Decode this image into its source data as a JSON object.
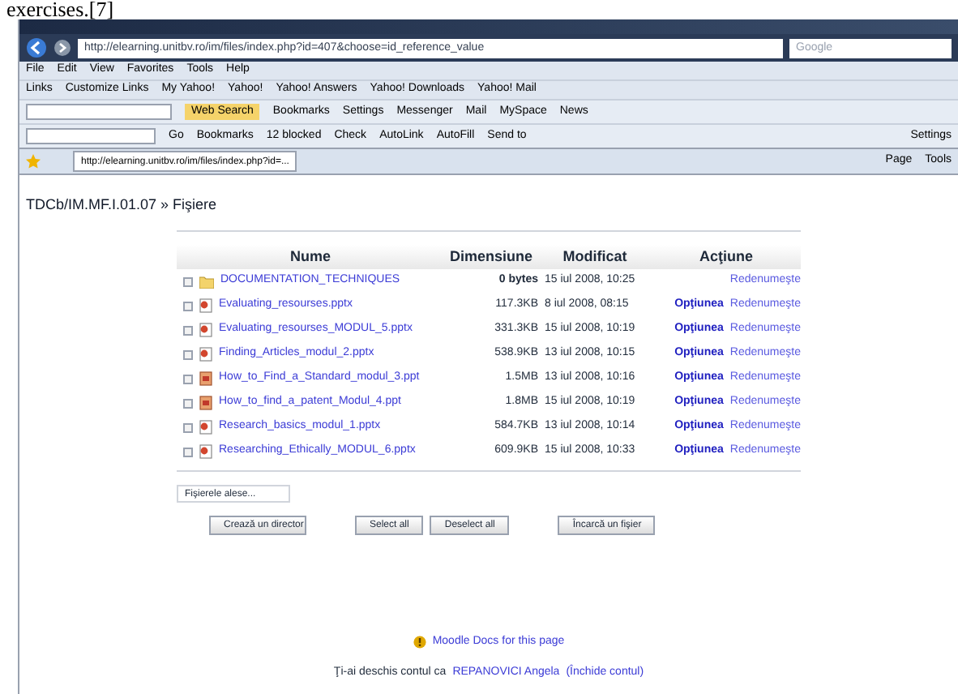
{
  "document_text": "exercises.[7]",
  "browser": {
    "address": "http://elearning.unitbv.ro/im/files/index.php?id=407&choose=id_reference_value",
    "search_placeholder": "Google",
    "menu": [
      "File",
      "Edit",
      "View",
      "Favorites",
      "Tools",
      "Help"
    ],
    "links_label": "Links",
    "links": [
      "Customize Links",
      "My Yahoo!",
      "Yahoo!",
      "Yahoo! Answers",
      "Yahoo! Downloads",
      "Yahoo! Mail"
    ],
    "yahoo_toolbar": [
      "Web Search",
      "Bookmarks",
      "Settings",
      "Messenger",
      "Mail",
      "MySpace",
      "News"
    ],
    "google_toolbar": [
      "Go",
      "Bookmarks",
      "12 blocked",
      "Check",
      "AutoLink",
      "AutoFill",
      "Send to",
      "Settings"
    ],
    "tab_title": "http://elearning.unitbv.ro/im/files/index.php?id=...",
    "command_bar": [
      "Page",
      "Tools"
    ]
  },
  "page": {
    "breadcrumb": "TDCb/IM.MF.I.01.07 » Fişiere",
    "columns": [
      "Nume",
      "Dimensiune",
      "Modificat",
      "Acţiune"
    ],
    "rows": [
      {
        "kind": "folder",
        "checked": false,
        "name": "DOCUMENTATION_TECHNIQUES",
        "size": "0 bytes",
        "modified": "15 iul 2008, 10:25",
        "rename": "Redenumeşte"
      },
      {
        "kind": "pptx",
        "checked": false,
        "name": "Evaluating_resourses.pptx",
        "size": "117.3KB",
        "modified": "8 iul 2008, 08:15",
        "options": "Opţiunea",
        "rename": "Redenumeşte"
      },
      {
        "kind": "pptx",
        "checked": false,
        "name": "Evaluating_resourses_MODUL_5.pptx",
        "size": "331.3KB",
        "modified": "15 iul 2008, 10:19",
        "options": "Opţiunea",
        "rename": "Redenumeşte"
      },
      {
        "kind": "pptx",
        "checked": false,
        "name": "Finding_Articles_modul_2.pptx",
        "size": "538.9KB",
        "modified": "13 iul 2008, 10:15",
        "options": "Opţiunea",
        "rename": "Redenumeşte"
      },
      {
        "kind": "ppt",
        "checked": false,
        "name": "How_to_Find_a_Standard_modul_3.ppt",
        "size": "1.5MB",
        "modified": "13 iul 2008, 10:16",
        "options": "Opţiunea",
        "rename": "Redenumeşte"
      },
      {
        "kind": "ppt",
        "checked": false,
        "name": "How_to_find_a_patent_Modul_4.ppt",
        "size": "1.8MB",
        "modified": "15 iul 2008, 10:19",
        "options": "Opţiunea",
        "rename": "Redenumeşte"
      },
      {
        "kind": "pptx",
        "checked": false,
        "name": "Research_basics_modul_1.pptx",
        "size": "584.7KB",
        "modified": "13 iul 2008, 10:14",
        "options": "Opţiunea",
        "rename": "Redenumeşte"
      },
      {
        "kind": "pptx",
        "checked": false,
        "name": "Researching_Ethically_MODUL_6.pptx",
        "size": "609.9KB",
        "modified": "15 iul 2008, 10:33",
        "options": "Opţiunea",
        "rename": "Redenumeşte"
      }
    ],
    "selection_menu": "Fişierele alese...",
    "buttons": [
      "Crează un director",
      "Select all",
      "Deselect all",
      "Încarcă un fişier"
    ],
    "docs_link": "Moodle Docs for this page",
    "login_prefix": "Ţi-ai deschis contul ca",
    "login_user": "REPANOVICI Angela",
    "logout_link": "(Închide contul)"
  }
}
